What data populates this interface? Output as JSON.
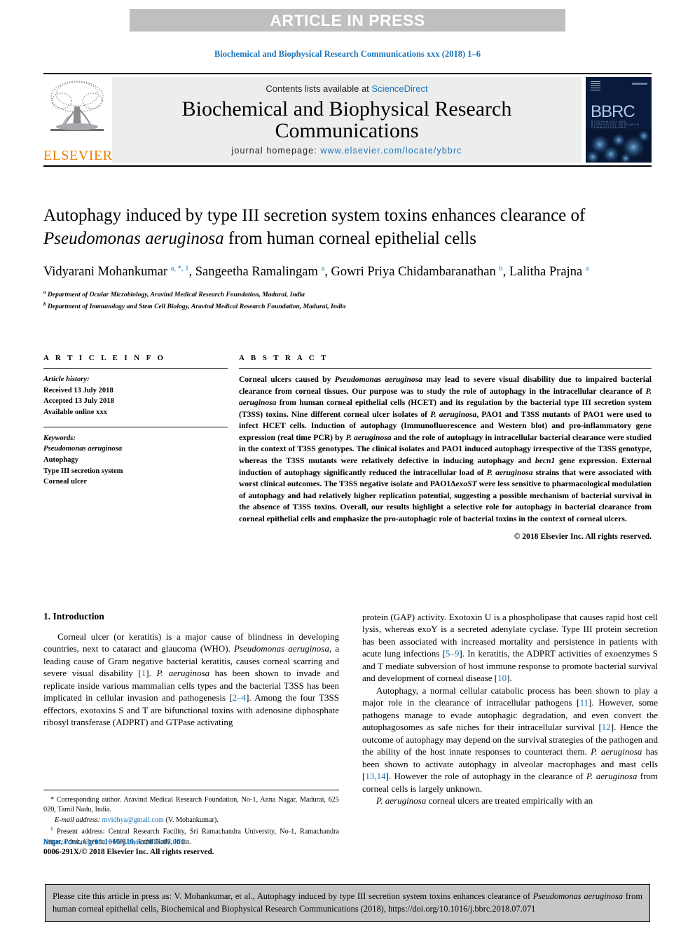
{
  "banner": {
    "label": "ARTICLE IN PRESS"
  },
  "journal_line": "Biochemical and Biophysical Research Communications xxx (2018) 1–6",
  "masthead": {
    "contents_prefix": "Contents lists available at ",
    "contents_link": "ScienceDirect",
    "journal_title": "Biochemical and Biophysical Research Communications",
    "homepage_label": "journal homepage: ",
    "homepage_url": "www.elsevier.com/locate/ybbrc",
    "publisher": "ELSEVIER",
    "cover_title": "BBRC",
    "cover_subtitle": "BIOCHEMICAL AND BIOPHYSICAL RESEARCH COMMUNICATIONS"
  },
  "article": {
    "title_part1": "Autophagy induced by type III secretion system toxins enhances clearance of ",
    "title_italic": "Pseudomonas aeruginosa",
    "title_part2": " from human corneal epithelial cells",
    "authors_html": "Vidyarani Mohankumar <sup>a, *, 1</sup>, Sangeetha Ramalingam <sup>a</sup>, Gowri Priya Chidambaranathan <sup>b</sup>, Lalitha Prajna <sup>a</sup>",
    "affiliation_a": "Department of Ocular Microbiology, Aravind Medical Research Foundation, Madurai, India",
    "affiliation_b": "Department of Immunology and Stem Cell Biology, Aravind Medical Research Foundation, Madurai, India"
  },
  "article_info": {
    "heading": "A R T I C L E   I N F O",
    "history_label": "Article history:",
    "received": "Received 13 July 2018",
    "accepted": "Accepted 13 July 2018",
    "available": "Available online xxx",
    "keywords_label": "Keywords:",
    "keywords": [
      "Pseudomonas aeruginosa",
      "Autophagy",
      "Type III secretion system",
      "Corneal ulcer"
    ]
  },
  "abstract": {
    "heading": "A B S T R A C T",
    "text_html": "Corneal ulcers caused by <i>Pseudomonas aeruginosa</i> may lead to severe visual disability due to impaired bacterial clearance from corneal tissues. Our purpose was to study the role of autophagy in the intracellular clearance of <i>P. aeruginosa</i> from human corneal epithelial cells (HCET) and its regulation by the bacterial type III secretion system (T3SS) toxins. Nine different corneal ulcer isolates of <i>P. aeruginosa</i>, PAO1 and T3SS mutants of PAO1 were used to infect HCET cells. Induction of autophagy (Immunofluorescence and Western blot) and pro-inflammatory gene expression (real time PCR) by <i>P. aeruginosa</i> and the role of autophagy in intracellular bacterial clearance were studied in the context of T3SS genotypes. The clinical isolates and PAO1 induced autophagy irrespective of the T3SS genotype, whereas the T3SS mutants were relatively defective in inducing autophagy and <i>becn1</i> gene expression. External induction of autophagy significantly reduced the intracellular load of <i>P. aeruginosa</i> strains that were associated with worst clinical outcomes. The T3SS negative isolate and PAO1Δ<i>exoST</i> were less sensitive to pharmacological modulation of autophagy and had relatively higher replication potential, suggesting a possible mechanism of bacterial survival in the absence of T3SS toxins. Overall, our results highlight a selective role for autophagy in bacterial clearance from corneal epithelial cells and emphasize the pro-autophagic role of bacterial toxins in the context of corneal ulcers.",
    "copyright": "© 2018 Elsevier Inc. All rights reserved."
  },
  "body": {
    "section_heading": "1. Introduction",
    "left_paragraphs_html": [
      "Corneal ulcer (or keratitis) is a major cause of blindness in developing countries, next to cataract and glaucoma (WHO). <i>Pseudomonas aeruginosa</i>, a leading cause of Gram negative bacterial keratitis, causes corneal scarring and severe visual disability [<span class=\"ref\">1</span>]. <i>P. aeruginosa</i> has been shown to invade and replicate inside various mammalian cells types and the bacterial T3SS has been implicated in cellular invasion and pathogenesis [<span class=\"ref\">2–4</span>]. Among the four T3SS effectors, exotoxins S and T are bifunctional toxins with adenosine diphosphate ribosyl transferase (ADPRT) and GTPase activating"
    ],
    "right_paragraphs_html": [
      "protein (GAP) activity. Exotoxin U is a phospholipase that causes rapid host cell lysis, whereas exoY is a secreted adenylate cyclase. Type III protein secretion has been associated with increased mortality and persistence in patients with acute lung infections [<span class=\"ref\">5–9</span>]. In keratitis, the ADPRT activities of exoenzymes S and T mediate subversion of host immune response to promote bacterial survival and development of corneal disease [<span class=\"ref\">10</span>].",
      "Autophagy, a normal cellular catabolic process has been shown to play a major role in the clearance of intracellular pathogens [<span class=\"ref\">11</span>]. However, some pathogens manage to evade autophagic degradation, and even convert the autophagosomes as safe niches for their intracellular survival [<span class=\"ref\">12</span>]. Hence the outcome of autophagy may depend on the survival strategies of the pathogen and the ability of the host innate responses to counteract them. <i>P. aeruginosa</i> has been shown to activate autophagy in alveolar macrophages and mast cells [<span class=\"ref\">13,14</span>]. However the role of autophagy in the clearance of <i>P. aeruginosa</i> from corneal cells is largely unknown.",
      "<i>P. aeruginosa</i> corneal ulcers are treated empirically with an"
    ]
  },
  "footnotes": {
    "corresponding_html": "* Corresponding author. Aravind Medical Research Foundation, No-1, Anna Nagar, Madurai, 625 020, Tamil Nadu, India.",
    "email_label": "E-mail address:",
    "email": "mvidhya@gmail.com",
    "email_owner": "(V. Mohankumar).",
    "present_address_html": "<sup>1</sup> Present address: Central Research Facility, Sri Ramachandra University, No-1, Ramachandra Nagar, Porur, Chennai –600116, Tamil Nadu, India."
  },
  "doi": {
    "url": "https://doi.org/10.1016/j.bbrc.2018.07.071",
    "issn_line": "0006-291X/© 2018 Elsevier Inc. All rights reserved."
  },
  "cite_box": {
    "text_html": "Please cite this article in press as: V. Mohankumar, et al., Autophagy induced by type III secretion system toxins enhances clearance of <i>Pseudomonas aeruginosa</i> from human corneal epithelial cells, Biochemical and Biophysical Research Communications (2018), https://doi.org/10.1016/j.bbrc.2018.07.071"
  },
  "colors": {
    "link_blue": "#1a75bb",
    "banner_gray": "#bfbfbf",
    "masthead_gray": "#eceded",
    "cite_gray": "#c6c6c6",
    "elsevier_orange": "#ef7d00",
    "bbrc_navy": "#0a1a3c"
  }
}
